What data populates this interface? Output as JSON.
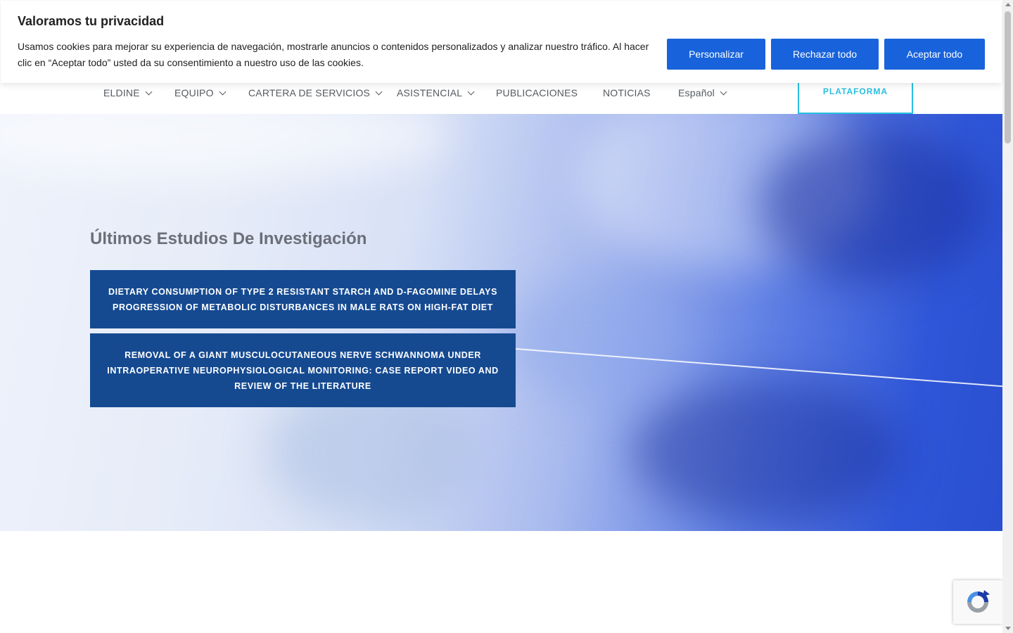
{
  "cookie_banner": {
    "title": "Valoramos tu privacidad",
    "text": "Usamos cookies para mejorar su experiencia de navegación, mostrarle anuncios o contenidos personalizados y analizar nuestro tráfico. Al hacer clic en “Aceptar todo” usted da su consentimiento a nuestro uso de las cookies.",
    "customize_label": "Personalizar",
    "reject_label": "Rechazar todo",
    "accept_label": "Aceptar todo",
    "button_color": "#1863dc"
  },
  "nav": {
    "items": [
      {
        "label": "ELDINE",
        "dropdown": true
      },
      {
        "label": "EQUIPO",
        "dropdown": true
      },
      {
        "label": "CARTERA DE SERVICIOS",
        "dropdown": true
      },
      {
        "label": "ASISTENCIAL",
        "dropdown": true
      },
      {
        "label": "PUBLICACIONES",
        "dropdown": false
      },
      {
        "label": "NOTICIAS",
        "dropdown": false
      },
      {
        "label": "Español",
        "dropdown": true
      }
    ],
    "platform_label": "PLATAFORMA",
    "platform_color": "#27bfe0"
  },
  "hero": {
    "title": "Últimos Estudios De Investigación",
    "studies": [
      "DIETARY CONSUMPTION OF TYPE 2 RESISTANT STARCH AND D-FAGOMINE DELAYS PROGRESSION OF METABOLIC DISTURBANCES IN MALE RATS ON HIGH-FAT DIET",
      "REMOVAL OF A GIANT MUSCULOCUTANEOUS NERVE SCHWANNOMA UNDER INTRAOPERATIVE NEUROPHYSIOLOGICAL MONITORING: CASE REPORT VIDEO AND REVIEW OF THE LITERATURE"
    ],
    "study_color": "#154a91"
  },
  "recaptcha": {
    "icon": "recaptcha-icon"
  }
}
